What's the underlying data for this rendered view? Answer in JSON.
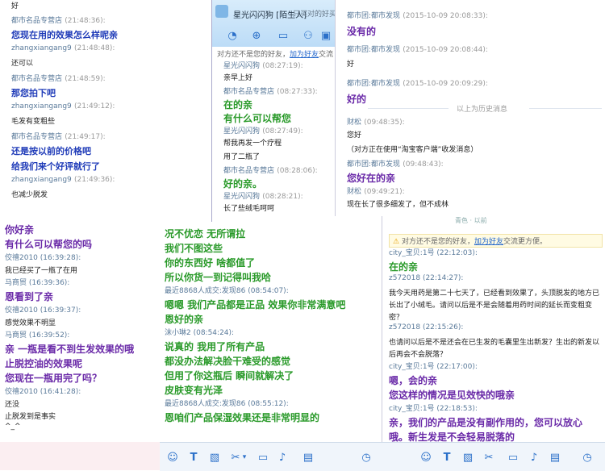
{
  "panelA": {
    "top_fragment": "好",
    "messages": [
      {
        "sender": "都市名品专营店",
        "time": "(21:48:36):",
        "text": "您现在用的效果怎么样呢亲",
        "style": "blue"
      },
      {
        "sender": "zhangxiangang9",
        "time": "(21:48:48):",
        "text": "还可以",
        "style": "plain"
      },
      {
        "sender": "都市名品专营店",
        "time": "(21:48:59):",
        "text": "那您拍下吧",
        "style": "blue"
      },
      {
        "sender": "zhangxiangang9",
        "time": "(21:49:12):",
        "text": "毛发有变粗些",
        "style": "plain"
      },
      {
        "sender": "都市名品专营店",
        "time": "(21:49:17):",
        "text": "还是按以前的价格吧",
        "style": "blue"
      },
      {
        "sender": "",
        "time": "",
        "text": "给我们来个好评就行了",
        "style": "blue"
      },
      {
        "sender": "zhangxiangang9",
        "time": "(21:49:36):",
        "text": "也减少脱发",
        "style": "plain"
      }
    ]
  },
  "panelB": {
    "title": "星光闪闪狗 [陌生人]",
    "subtitle": "只买对的好买",
    "warning": "对方还不是您的好友，",
    "warning_link": "加为好友",
    "warning_tail": "交流",
    "messages": [
      {
        "sender": "星光闪闪狗",
        "time": "(08:27:19):",
        "text": "亲早上好",
        "style": "plain"
      },
      {
        "sender": "都市名品专营店",
        "time": "(08:27:33):",
        "text": "在的亲",
        "style": "green"
      },
      {
        "sender": "",
        "time": "",
        "text": "有什么可以帮您",
        "style": "green"
      },
      {
        "sender": "星光闪闪狗",
        "time": "(08:27:49):",
        "text": "帮我再发一个疗程",
        "style": "plain"
      },
      {
        "sender": "",
        "time": "",
        "text": "用了二瓶了",
        "style": "plain"
      },
      {
        "sender": "都市名品专营店",
        "time": "(08:28:06):",
        "text": "好的亲。",
        "style": "green"
      },
      {
        "sender": "星光闪闪狗",
        "time": "(08:28:21):",
        "text": "长了些绒毛呵呵",
        "style": "plain"
      }
    ]
  },
  "panelC": {
    "messages": [
      {
        "sender": "都市团:都市发现",
        "time": "(2015-10-09 20:08:33):",
        "text": "没有的",
        "style": "purple"
      },
      {
        "sender": "都市团:都市发现",
        "time": "(2015-10-09 20:08:44):",
        "text": "好",
        "style": "plain"
      },
      {
        "sender": "都市团:都市发现",
        "time": "(2015-10-09 20:09:29):",
        "text": "好的",
        "style": "purple"
      }
    ],
    "history_label": "以上为历史消息",
    "messages2": [
      {
        "sender": "财松",
        "time": "(09:48:35):",
        "text": "您好",
        "style": "plain"
      },
      {
        "sender": "",
        "time": "",
        "text": "（对方正在使用“淘宝客户端”收发消息）",
        "style": "plain"
      },
      {
        "sender": "都市团:都市发现",
        "time": "(09:48:43):",
        "text": "您好在的亲",
        "style": "purple"
      },
      {
        "sender": "财松",
        "time": "(09:49:21):",
        "text": "现在长了很多细发了，但不成林",
        "style": "plain"
      }
    ]
  },
  "panelD": {
    "lines": [
      {
        "text": "你好亲",
        "style": "purple"
      },
      {
        "text": "有什么可以帮您的吗",
        "style": "purple"
      },
      {
        "text": "佼禧2010 (16:39:28):",
        "style": "sender"
      },
      {
        "text": "我已经买了一瓶了在用",
        "style": "plain"
      },
      {
        "text": "马商贸 (16:39:36):",
        "style": "sender"
      },
      {
        "text": "恩看到了亲",
        "style": "purple"
      },
      {
        "text": "佼禧2010 (16:39:37):",
        "style": "sender"
      },
      {
        "text": "感觉效果不明显",
        "style": "plain"
      },
      {
        "text": "马商贸 (16:39:52):",
        "style": "sender"
      },
      {
        "text": "亲 一瓶是看不到生发效果的哦",
        "style": "purple"
      },
      {
        "text": "止脱控油的效果呢",
        "style": "purple"
      },
      {
        "text": "您现在一瓶用完了吗？",
        "style": "purple"
      },
      {
        "text": "佼禧2010 (16:41:28):",
        "style": "sender"
      },
      {
        "text": "还没",
        "style": "plain"
      },
      {
        "text": "止脱发到是事实",
        "style": "plain"
      },
      {
        "text": "^_^",
        "style": "plain"
      }
    ]
  },
  "panelE": {
    "lines": [
      {
        "text": "况不优恋 无所谓拉",
        "style": "green"
      },
      {
        "text": "我们不图这些",
        "style": "green"
      },
      {
        "text": "你的东西好 啥都值了",
        "style": "green"
      },
      {
        "text": "所以你货一到记得叫我哈",
        "style": "green"
      },
      {
        "text": "最近8868人成交:发现86 (08:54:07):",
        "style": "sender"
      },
      {
        "text": "嗯嗯 我们产品都是正品 效果你非常满意吧",
        "style": "green"
      },
      {
        "text": "恩好的亲",
        "style": "green"
      },
      {
        "text": "沫小琳2 (08:54:24):",
        "style": "sender"
      },
      {
        "text": "说真的 我用了所有产品",
        "style": "green"
      },
      {
        "text": "都没办法解决脸干难受的感觉",
        "style": "green"
      },
      {
        "text": "但用了你这瓶后 瞬间就解决了",
        "style": "green"
      },
      {
        "text": "皮肤变有光泽",
        "style": "green"
      },
      {
        "text": "最近8868人成交:发现86 (08:55:12):",
        "style": "sender"
      },
      {
        "text": "恩咱们产品保湿效果还是非常明显的",
        "style": "green"
      }
    ]
  },
  "panelF": {
    "top_label": "青色 · 以前",
    "warning": "对方还不是您的好友，",
    "warning_link": "加为好友",
    "warning_tail": "交流更方便。",
    "lines": [
      {
        "text": "city_宝贝:1号 (22:12:03):",
        "style": "sender"
      },
      {
        "text": "在的亲",
        "style": "green"
      },
      {
        "text": "z572018 (22:14:27):",
        "style": "sender"
      },
      {
        "text": "我今天用药是第二十七天了，已经看到效果了，头顶脱发的地方已",
        "style": "plain"
      },
      {
        "text": "长出了小绒毛。请问以后是不是会随着用药时间的延长而变粗变",
        "style": "plain"
      },
      {
        "text": "密？",
        "style": "plain"
      },
      {
        "text": "z572018 (22:15:26):",
        "style": "sender"
      },
      {
        "text": "也请问以后是不是还会在已生发的毛囊里生出新发？生出的新发以",
        "style": "plain"
      },
      {
        "text": "后再会不会脱落？",
        "style": "plain"
      },
      {
        "text": "city_宝贝:1号 (22:17:00):",
        "style": "sender"
      },
      {
        "text": "嗯，会的亲",
        "style": "purple"
      },
      {
        "text": "您这样的情况是见效快的哦亲",
        "style": "purple"
      },
      {
        "text": "city_宝贝:1号 (22:18:53):",
        "style": "sender"
      },
      {
        "text": "亲，我们的产品是没有副作用的，您可以放心",
        "style": "purple"
      },
      {
        "text": "哦。新生发是不会轻易脱落的",
        "style": "purple"
      }
    ]
  }
}
